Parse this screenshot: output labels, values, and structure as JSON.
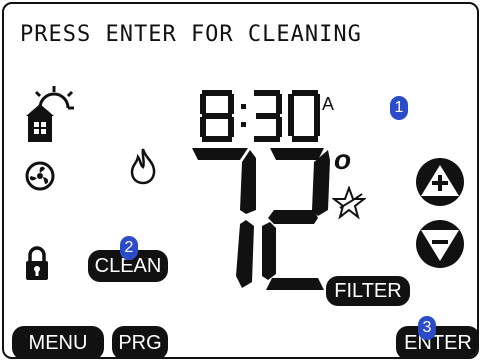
{
  "display": {
    "message": "PRESS ENTER FOR CLEANING",
    "time": "8:30",
    "ampm": "A",
    "temperature": "72",
    "degree_symbol": "o"
  },
  "buttons": {
    "clean": "CLEAN",
    "filter": "FILTER",
    "menu": "MENU",
    "prg": "PRG",
    "enter": "ENTER"
  },
  "markers": [
    "1",
    "2",
    "3"
  ],
  "icons": {
    "weather_home": "sun-house-icon",
    "fan": "fan-icon",
    "heat": "flame-icon",
    "lock": "lock-icon",
    "star": "energy-star-icon",
    "up": "plus-circle-icon",
    "down": "minus-circle-icon"
  },
  "colors": {
    "lcd_ink": "#111111",
    "marker": "#2b4cc8"
  }
}
